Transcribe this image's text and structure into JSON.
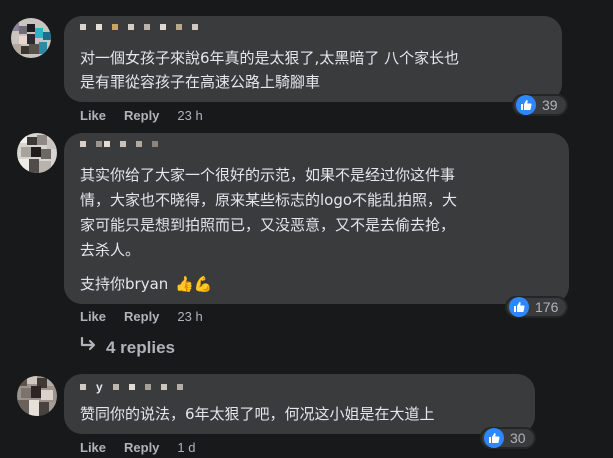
{
  "comments": [
    {
      "text_lines": [
        "对一個女孩子來說6年真的是太狠了,太黑暗了 八个家长也",
        "是有罪從容孩子在高速公路上騎腳車"
      ],
      "like_label": "Like",
      "reply_label": "Reply",
      "time": "23 h",
      "reaction_count": "39"
    },
    {
      "text_lines": [
        "其实你给了大家一个很好的示范，如果不是经过你这件事",
        "情，大家也不晓得，原来某些标志的logo不能乱拍照，大",
        "家可能只是想到拍照而已，又没恶意，又不是去偷去抢，",
        "去杀人。"
      ],
      "extra_line": "支持你bryan",
      "extra_emoji": "👍💪",
      "like_label": "Like",
      "reply_label": "Reply",
      "time": "23 h",
      "reaction_count": "176"
    },
    {
      "name_fragment": "y",
      "text_lines": [
        "赞同你的说法，6年太狠了吧，何况这小姐是在大道上"
      ],
      "like_label": "Like",
      "reply_label": "Reply",
      "time": "1 d",
      "reaction_count": "30"
    }
  ],
  "replies_link": "4 replies",
  "colors": {
    "background": "#18191a",
    "bubble": "#3a3b3c",
    "text": "#e4e6eb",
    "secondary_text": "#b0b3b8",
    "like_blue": "#2d88ff"
  },
  "icons": [
    "thumbs-up-icon",
    "reply-arrow-icon"
  ]
}
